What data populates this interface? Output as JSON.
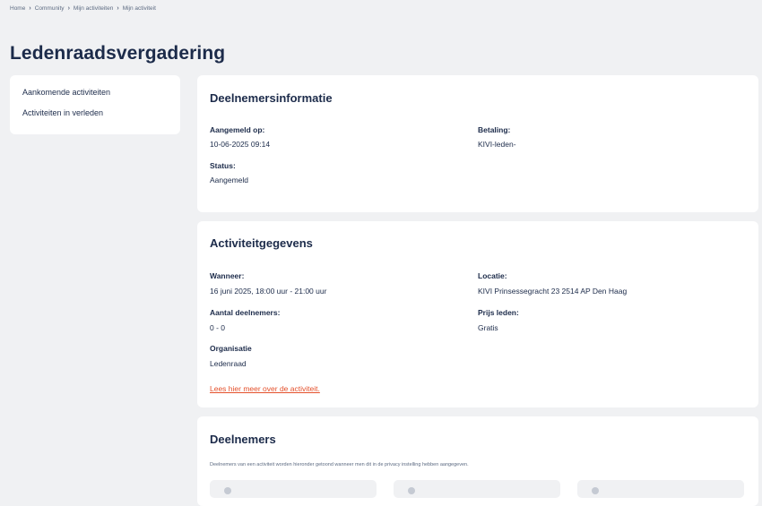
{
  "breadcrumb": {
    "items": [
      "Home",
      "Community",
      "Mijn activiteiten",
      "Mijn activiteit"
    ],
    "separator": "›"
  },
  "page": {
    "title": "Ledenraadsvergadering"
  },
  "sidebar": {
    "items": [
      {
        "label": "Aankomende activiteiten"
      },
      {
        "label": "Activiteiten in verleden"
      }
    ]
  },
  "participant_info": {
    "title": "Deelnemersinformatie",
    "registered_label": "Aangemeld op:",
    "registered_value": "10-06-2025 09:14",
    "payment_label": "Betaling:",
    "payment_value": "KIVI-leden-",
    "status_label": "Status:",
    "status_value": "Aangemeld"
  },
  "activity": {
    "title": "Activiteitgegevens",
    "when_label": "Wanneer:",
    "when_value": "16 juni 2025, 18:00 uur - 21:00 uur",
    "location_label": "Locatie:",
    "location_value": "KIVI Prinsessegracht 23 2514 AP Den Haag",
    "count_label": "Aantal deelnemers:",
    "count_value": "0 - 0",
    "price_label": "Prijs leden:",
    "price_value": "Gratis",
    "org_label": "Organisatie",
    "org_value": "Ledenraad",
    "more_link": "Lees hier meer over de activiteit."
  },
  "participants": {
    "title": "Deelnemers",
    "note": "Deelnemers van een activiteit worden hieronder getoond wanneer men dit in de privacy instelling hebben aangegeven."
  },
  "colors": {
    "accent_link": "#e4502b",
    "text": "#1c2b4a",
    "background": "#f0f1f3"
  }
}
